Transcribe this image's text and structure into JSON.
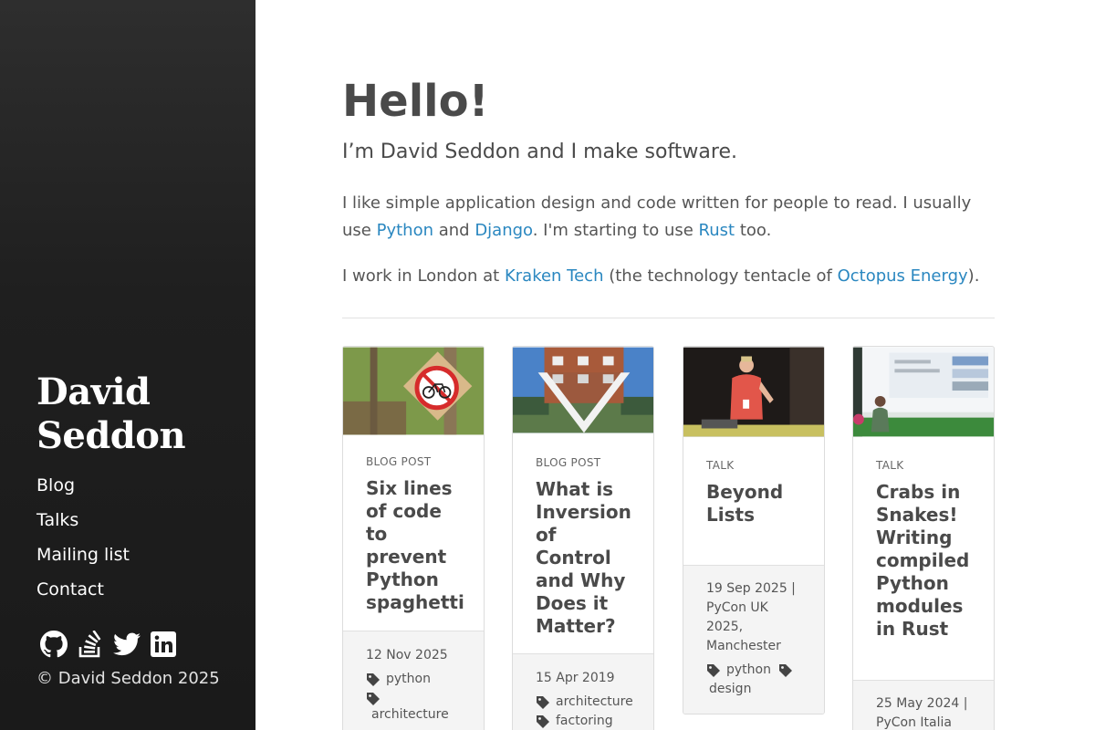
{
  "sidebar": {
    "site_name": "David Seddon",
    "nav": [
      "Blog",
      "Talks",
      "Mailing list",
      "Contact"
    ],
    "social_icons": [
      "github-icon",
      "stackoverflow-icon",
      "twitter-icon",
      "linkedin-icon"
    ],
    "copyright": "© David Seddon 2025"
  },
  "intro": {
    "heading": "Hello!",
    "tagline": "I’m David Seddon and I make software.",
    "p1_a": "I like simple application design and code written for people to read. I usually use ",
    "p1_python": "Python",
    "p1_and": " and ",
    "p1_django": "Django",
    "p1_b": ". I'm starting to use ",
    "p1_rust": "Rust",
    "p1_c": " too.",
    "p2_a": "I work in London at ",
    "p2_kraken": "Kraken Tech",
    "p2_b": " (the technology tentacle of ",
    "p2_octopus": "Octopus Energy",
    "p2_c": ")."
  },
  "cards": [
    {
      "kind": "BLOG POST",
      "title": "Six lines of code to prevent Python spaghetti",
      "meta": "12 Nov 2025",
      "tags": [
        "python",
        "architecture"
      ]
    },
    {
      "kind": "BLOG POST",
      "title": "What is Inversion of Control and Why Does it Matter?",
      "meta": "15 Apr 2019",
      "tags": [
        "architecture",
        "factoring"
      ]
    },
    {
      "kind": "TALK",
      "title": "Beyond Lists",
      "meta": "19 Sep 2025 | PyCon UK 2025, Manchester",
      "tags": [
        "python",
        "design"
      ]
    },
    {
      "kind": "TALK",
      "title": "Crabs in Snakes! Writing compiled Python modules in Rust",
      "meta": "25 May 2024 | PyCon Italia",
      "tags": []
    }
  ],
  "colors": {
    "link": "#2a87c0",
    "sidebar": "#1f1f1f",
    "text": "#4a4a4a"
  }
}
